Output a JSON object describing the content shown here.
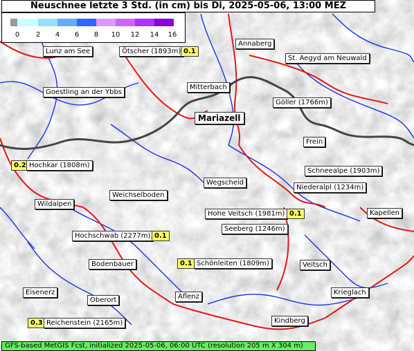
{
  "title": "Neuschnee letzte 3 Std. (in cm) bis Di, 2025-05-06, 13:00 MEZ",
  "legend": {
    "ticks": [
      "0",
      "2",
      "4",
      "6",
      "8",
      "10",
      "12",
      "14",
      "16"
    ],
    "colors": [
      "#999999",
      "#ccffff",
      "#99ddff",
      "#66aaff",
      "#3366ff",
      "#dd99ff",
      "#cc66ff",
      "#aa33ff",
      "#8800dd"
    ]
  },
  "places": {
    "lunz": "Lunz am See",
    "oetscher": "Ötscher (1893m)",
    "annaberg": "Annaberg",
    "st_aegyd": "St. Aegyd am Neuwald",
    "goestling": "Goestling an der Ybbs",
    "mitterbach": "Mitterbach",
    "goeller": "Göller (1766m)",
    "mariazell": "Mariazell",
    "frein": "Frein",
    "hochkar": "Hochkar (1808m)",
    "schneealpe": "Schneealpe (1903m)",
    "wegscheid": "Wegscheid",
    "niederalpl": "Niederalpl (1234m)",
    "weichselboden": "Weichselboden",
    "wildalpen": "Wildalpen",
    "hohe_veitsch": "Hohe Veitsch (1981m)",
    "kapellen": "Kapellen",
    "seeberg": "Seeberg (1246m)",
    "hochschwab": "Hochschwab (2277m)",
    "bodenbauer": "Bodenbauer",
    "schoenleiten": "Schönleiten (1809m)",
    "veitsch": "Veitsch",
    "eisenerz": "Eisenerz",
    "oberort": "Oberort",
    "aflenz": "Aflenz",
    "krieglach": "Krieglach",
    "kindberg": "Kindberg",
    "reichenstein": "Reichenstein (2165m)"
  },
  "values": {
    "oetscher": "0.1",
    "hochkar": "0.2",
    "hohe_veitsch": "0.1",
    "hochschwab": "0.1",
    "schoenleiten": "0.1",
    "reichenstein": "0.3"
  },
  "footer": "GFS-based MetGIS Fcst, initialized 2025-05-06, 06:00 UTC  (resolution 205 m X 304 m)"
}
